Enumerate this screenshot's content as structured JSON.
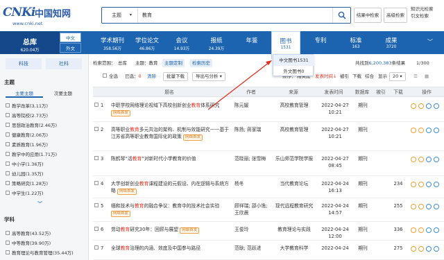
{
  "header": {
    "logo_mark": "CNKi",
    "logo_cn": "中国知网",
    "logo_url": "www.cnki.net",
    "search_field": "主题",
    "search_value": "教育",
    "in_results_label": "结果中检索",
    "advanced_label": "高级检索",
    "right_line1": "知识元检索",
    "right_line2": "引文检索"
  },
  "nav": {
    "total_title": "总库",
    "total_count": "620.04万",
    "lang_cn": "中文",
    "lang_foreign": "外文",
    "items": [
      {
        "name": "学术期刊",
        "count": "358.56万"
      },
      {
        "name": "学位论文",
        "count": "46.86万"
      },
      {
        "name": "会议",
        "count": "14.93万"
      },
      {
        "name": "报纸",
        "count": "24.39万"
      },
      {
        "name": "年鉴",
        "count": ""
      },
      {
        "name": "图书",
        "count": "1531"
      },
      {
        "name": "专利",
        "count": ""
      },
      {
        "name": "标准",
        "count": "163"
      },
      {
        "name": "成果",
        "count": "3720"
      }
    ],
    "dropdown": [
      "中文图书1531",
      "外文图书0"
    ]
  },
  "sidebar": {
    "tabs": [
      "科技",
      "社科"
    ],
    "topic_title": "主题",
    "topic_sub": [
      "主要主题",
      "次要主题"
    ],
    "topic_items": [
      "教学改革(3.11万)",
      "高等院校(2.73万)",
      "思想政治教育(2.46万)",
      "健康教育(2.06万)",
      "素质教育(1.96万)",
      "教学中的应用(1.71万)",
      "中小学(1.36万)",
      "幼儿园(1.35万)",
      "策略研究(1.28万)",
      "中学生(1.22万)"
    ],
    "subject_title": "学科",
    "subject_items": [
      "高等教育(43.52万)",
      "中等教育(39.90万)",
      "教育理论与教育管理(35.44万)"
    ]
  },
  "toolbar": {
    "scope_label": "检索范围：",
    "scope_db": "总库",
    "scope_field": "主题：教育",
    "theme_map": "主题定制",
    "history": "检索历史",
    "found_prefix": "共找到",
    "found_count": "6,200,383",
    "found_suffix": "条结果",
    "page": "1/300",
    "select_all": "全选",
    "selected_label": "已选：",
    "selected_count": "0",
    "clear": "清除",
    "batch_download": "批量下载",
    "export": "导出与分析",
    "sort_label": "排序：",
    "sort_relevance": "相关度",
    "sort_date": "发表时间",
    "sort_cited": "被引",
    "sort_download": "下载",
    "sort_synth": "综合",
    "display_label": "显示",
    "display_count": "20"
  },
  "table": {
    "headers": [
      "题名",
      "作者",
      "来源",
      "发表时间",
      "数据库",
      "被引",
      "下载",
      "操作"
    ],
    "badge": "网络首发",
    "rows": [
      {
        "num": "1",
        "title_pre": "中职学校网络理论视域下高校创新创业",
        "kw": "教育",
        "title_post": "体系研究",
        "badge": true,
        "author": "陈元媛",
        "source": "高校教育管理",
        "date": "2022-04-27",
        "time": "10:21",
        "db": "期刊",
        "cited": "",
        "download": ""
      },
      {
        "num": "2",
        "title_pre": "高等职业",
        "kw": "教育",
        "title_post": "多元共治的架构、机制与效能研究——基于江苏省高等职业教育国际化的政策",
        "badge": true,
        "author": "陈扬; 蒋家瑞",
        "source": "高校教育管理",
        "date": "2022-04-27",
        "time": "10:21",
        "db": "期刊",
        "cited": "",
        "download": ""
      },
      {
        "num": "3",
        "title_pre": "陈鹤琴“活",
        "kw": "教育",
        "title_post": "”对新时代小学教育的价值",
        "badge": false,
        "author": "范晓丽; 张雪梅",
        "source": "乐山师范学院学报",
        "date": "2022-04-27",
        "time": "08:45",
        "db": "期刊",
        "cited": "",
        "download": ""
      },
      {
        "num": "4",
        "title_pre": "大学创新创业",
        "kw": "教育",
        "title_post": "课程建设的元假设、内在逻辑与系统方略",
        "badge": true,
        "author": "杨冬",
        "source": "当代教育论坛",
        "date": "2022-04-24",
        "time": "16:13",
        "db": "期刊",
        "cited": "",
        "download": "234"
      },
      {
        "num": "5",
        "title_pre": "缅和技术与",
        "kw": "教育",
        "title_post": "的融合争议：教育中的技术社会实验",
        "badge": true,
        "author": "顾祥瑞; 邵小逸; 王欣晨",
        "source": "现代远程教育研究",
        "date": "2022-04-24",
        "time": "14:57",
        "db": "期刊",
        "cited": "",
        "download": "255"
      },
      {
        "num": "6",
        "title_pre": "劳动",
        "kw": "教育",
        "title_post": "研究30年：回顾与展望",
        "badge": true,
        "author": "王俊玲",
        "source": "教育理论与实践",
        "date": "2022-04-24",
        "time": "12:00",
        "db": "期刊",
        "cited": "",
        "download": "336"
      },
      {
        "num": "7",
        "title_pre": "全球",
        "kw": "教育",
        "title_post": "治理的内涵、效度及中国参与路径",
        "badge": false,
        "author": "范耿; 范跃进",
        "source": "大学教育科学",
        "date": "2022-04-24",
        "time": "",
        "db": "期刊",
        "cited": "",
        "download": "275"
      }
    ]
  },
  "colors": {
    "brand": "#1d64b0",
    "brand_dark": "#14488a",
    "keyword": "#e0301e",
    "badge": "#e07a10",
    "arrow": "#e0301e"
  }
}
